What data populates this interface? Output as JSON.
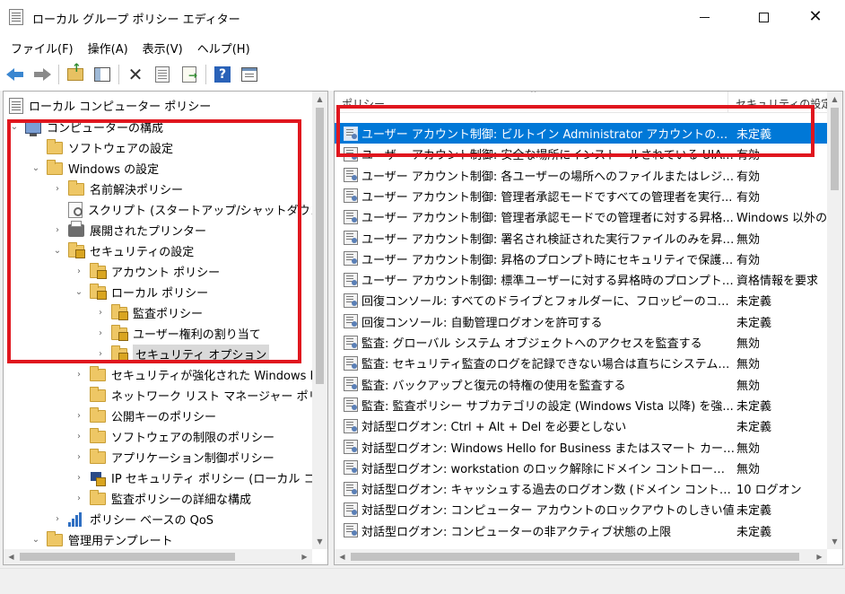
{
  "window": {
    "title": "ローカル グループ ポリシー エディター",
    "minimize_glyph": "",
    "close_glyph": "✕"
  },
  "menu": [
    "ファイル(F)",
    "操作(A)",
    "表示(V)",
    "ヘルプ(H)"
  ],
  "toolbar": {
    "icons": [
      "back-arrow-icon",
      "forward-arrow-icon",
      "up-folder-icon",
      "show-hide-tree-icon",
      "delete-icon",
      "properties-icon",
      "export-list-icon",
      "help-icon",
      "view-icon"
    ],
    "help_glyph": "?"
  },
  "tree": {
    "root": "ローカル コンピューター ポリシー",
    "chevron_expanded": "⌄",
    "chevron_collapsed": "›",
    "items": [
      {
        "label": "コンピューターの構成",
        "state": "expanded"
      },
      {
        "label": "ソフトウェアの設定",
        "state": "none"
      },
      {
        "label": "Windows の設定",
        "state": "expanded"
      },
      {
        "label": "名前解決ポリシー",
        "state": "collapsed"
      },
      {
        "label": "スクリプト (スタートアップ/シャットダウン)",
        "state": "none"
      },
      {
        "label": "展開されたプリンター",
        "state": "collapsed"
      },
      {
        "label": "セキュリティの設定",
        "state": "expanded"
      },
      {
        "label": "アカウント ポリシー",
        "state": "collapsed"
      },
      {
        "label": "ローカル ポリシー",
        "state": "expanded"
      },
      {
        "label": "監査ポリシー",
        "state": "collapsed"
      },
      {
        "label": "ユーザー権利の割り当て",
        "state": "collapsed"
      },
      {
        "label": "セキュリティ オプション",
        "state": "collapsed",
        "selected": true
      },
      {
        "label": "セキュリティが強化された Windows D",
        "state": "collapsed"
      },
      {
        "label": "ネットワーク リスト マネージャー ポリシー",
        "state": "none"
      },
      {
        "label": "公開キーのポリシー",
        "state": "collapsed"
      },
      {
        "label": "ソフトウェアの制限のポリシー",
        "state": "collapsed"
      },
      {
        "label": "アプリケーション制御ポリシー",
        "state": "collapsed"
      },
      {
        "label": "IP セキュリティ ポリシー (ローカル コンピ",
        "state": "collapsed"
      },
      {
        "label": "監査ポリシーの詳細な構成",
        "state": "collapsed"
      },
      {
        "label": "ポリシー ベースの QoS",
        "state": "collapsed"
      },
      {
        "label": "管理用テンプレート",
        "state": "expanded"
      }
    ]
  },
  "list": {
    "columns": {
      "policy": "ポリシー",
      "setting": "セキュリティの設定"
    },
    "sort_caret": "^",
    "rows": [
      {
        "policy": "ユーザー アカウント制御: ビルトイン Administrator アカウントのための...",
        "setting": "未定義",
        "selected": true
      },
      {
        "policy": "ユーザー アカウント制御: 安全な場所にインストールされている UIAcces...",
        "setting": "有効"
      },
      {
        "policy": "ユーザー アカウント制御: 各ユーザーの場所へのファイルまたはレジストリ...",
        "setting": "有効"
      },
      {
        "policy": "ユーザー アカウント制御: 管理者承認モードですべての管理者を実行...",
        "setting": "有効"
      },
      {
        "policy": "ユーザー アカウント制御: 管理者承認モードでの管理者に対する昇格...",
        "setting": "Windows 以外の"
      },
      {
        "policy": "ユーザー アカウント制御: 署名され検証された実行ファイルのみを昇格...",
        "setting": "無効"
      },
      {
        "policy": "ユーザー アカウント制御: 昇格のプロンプト時にセキュリティで保護され...",
        "setting": "有効"
      },
      {
        "policy": "ユーザー アカウント制御: 標準ユーザーに対する昇格時のプロンプトの...",
        "setting": "資格情報を要求"
      },
      {
        "policy": "回復コンソール: すべてのドライブとフォルダーに、フロッピーのコピーとアクセ...",
        "setting": "未定義"
      },
      {
        "policy": "回復コンソール: 自動管理ログオンを許可する",
        "setting": "未定義"
      },
      {
        "policy": "監査: グローバル システム オブジェクトへのアクセスを監査する",
        "setting": "無効"
      },
      {
        "policy": "監査: セキュリティ監査のログを記録できない場合は直ちにシステムを...",
        "setting": "無効"
      },
      {
        "policy": "監査: バックアップと復元の特権の使用を監査する",
        "setting": "無効"
      },
      {
        "policy": "監査: 監査ポリシー サブカテゴリの設定 (Windows Vista 以降) を強...",
        "setting": "未定義"
      },
      {
        "policy": "対話型ログオン: Ctrl + Alt + Del を必要としない",
        "setting": "未定義"
      },
      {
        "policy": "対話型ログオン: Windows Hello for Business またはスマート カード...",
        "setting": "無効"
      },
      {
        "policy": "対話型ログオン: workstation のロック解除にドメイン コントローラーの...",
        "setting": "無効"
      },
      {
        "policy": "対話型ログオン: キャッシュする過去のログオン数 (ドメイン コントローラー...",
        "setting": "10 ログオン"
      },
      {
        "policy": "対話型ログオン: コンピューター アカウントのロックアウトのしきい値",
        "setting": "未定義"
      },
      {
        "policy": "対話型ログオン: コンピューターの非アクティブ状態の上限",
        "setting": "未定義"
      }
    ]
  },
  "scroll_arrows": {
    "up": "▲",
    "down": "▼",
    "left": "◀",
    "right": "▶"
  },
  "colors": {
    "selection": "#0078d7",
    "annotation_red": "#e0161e",
    "folder": "#eec765"
  }
}
